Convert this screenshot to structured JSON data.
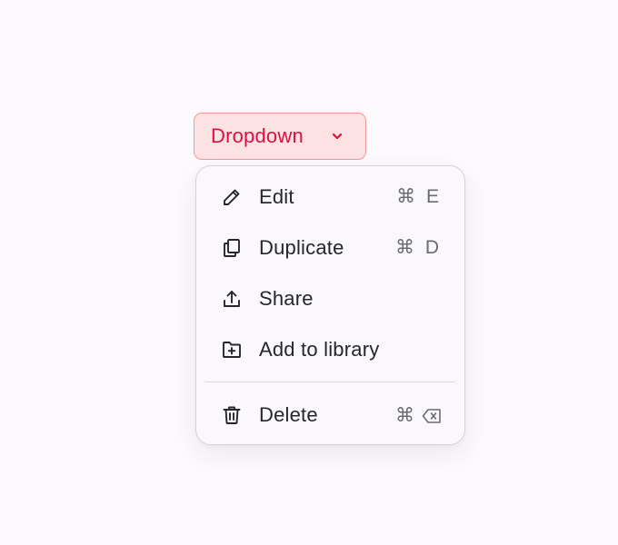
{
  "trigger": {
    "label": "Dropdown",
    "icon": "chevron-down-icon",
    "accent_text": "#de1040",
    "accent_bg": "#fde2e4",
    "accent_border": "#f59a9a"
  },
  "menu": {
    "items": [
      {
        "label": "Edit",
        "icon": "pencil-icon",
        "shortcut": "⌘ E"
      },
      {
        "label": "Duplicate",
        "icon": "copy-icon",
        "shortcut": "⌘ D"
      },
      {
        "label": "Share",
        "icon": "upload-icon",
        "shortcut": ""
      },
      {
        "label": "Add to library",
        "icon": "folder-plus-icon",
        "shortcut": ""
      }
    ],
    "danger_item": {
      "label": "Delete",
      "icon": "trash-icon",
      "shortcut_symbol": "⌘",
      "shortcut_key_icon": "backspace-icon"
    }
  }
}
